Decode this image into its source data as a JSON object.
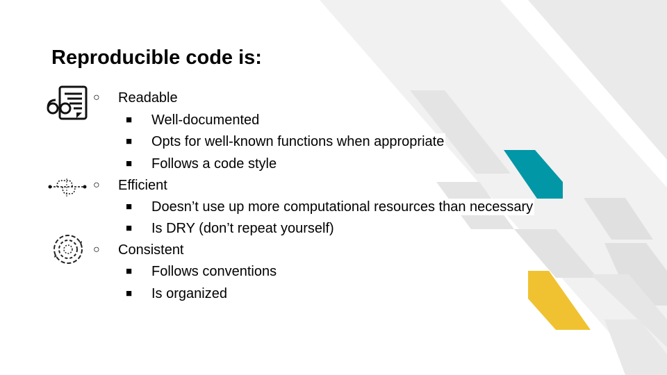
{
  "slide": {
    "title": "Reproducible code is:",
    "accent_colors": {
      "teal": "#0197A7",
      "yellow": "#F0C232",
      "gray": "#E6E6E6",
      "light_gray": "#F1F1F1"
    },
    "groups": [
      {
        "icon": "reading-glasses-document-icon",
        "label": "Readable",
        "bullet": "○",
        "items": [
          "Well-documented",
          "Opts for  well-known functions when appropriate",
          "Follows a code style"
        ]
      },
      {
        "icon": "efficient-path-icon",
        "label": "Efficient",
        "bullet": "○",
        "items": [
          "Doesn’t use up more computational resources than necessary",
          "Is DRY (don’t repeat yourself)"
        ]
      },
      {
        "icon": "consistent-cycle-icon",
        "label": "Consistent",
        "bullet": "○",
        "items": [
          "Follows conventions",
          "Is organized"
        ]
      }
    ],
    "sub_bullet": "■"
  }
}
